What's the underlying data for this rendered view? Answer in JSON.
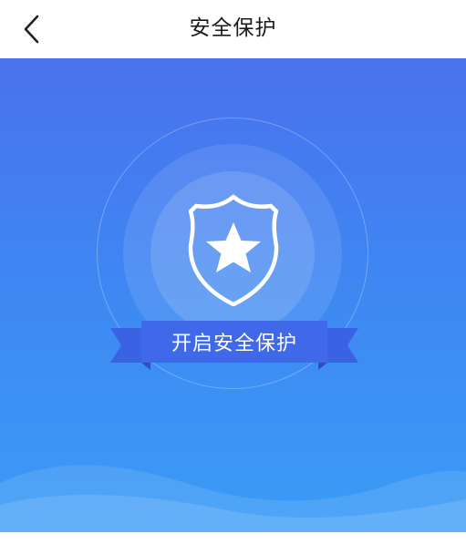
{
  "header": {
    "title": "安全保护",
    "back_icon": "chevron-left-icon"
  },
  "hero": {
    "badge_icon": "shield-star-icon",
    "action_label": "开启安全保护"
  },
  "colors": {
    "gradient_top": "#4a72ee",
    "gradient_bottom": "#3a9cf6",
    "ribbon": "#3a63e3",
    "ribbon_fold": "#2c4fc6"
  }
}
